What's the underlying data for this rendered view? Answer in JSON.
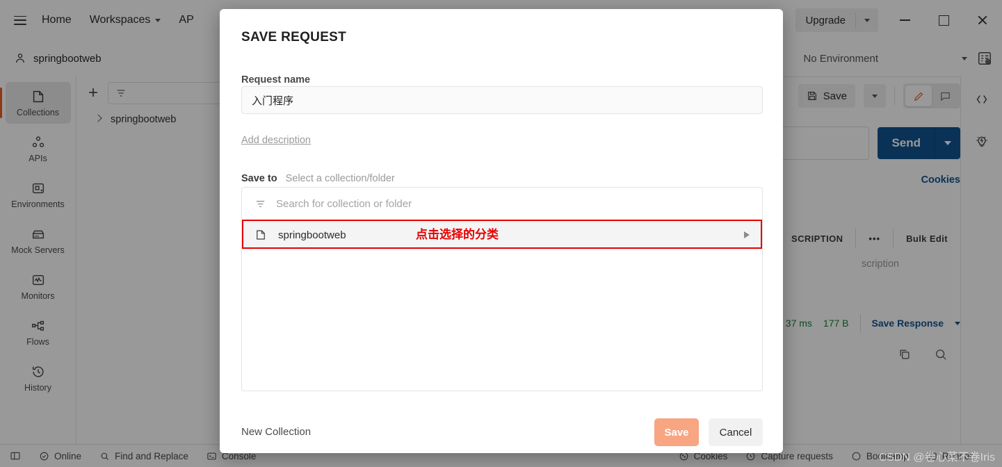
{
  "topbar": {
    "menu_icon": "hamburger-icon",
    "home": "Home",
    "workspaces": "Workspaces",
    "apis_partial": "AP",
    "upgrade": "Upgrade",
    "window_minimize": "minimize-icon",
    "window_maximize": "maximize-icon",
    "window_close": "close-icon"
  },
  "workspace_bar": {
    "name": "springbootweb",
    "environment": "No Environment",
    "env_quicklook_icon": "environment-quicklook-icon"
  },
  "sidebar": {
    "items": [
      {
        "label": "Collections",
        "icon": "collections-icon",
        "active": true
      },
      {
        "label": "APIs",
        "icon": "apis-icon",
        "active": false
      },
      {
        "label": "Environments",
        "icon": "environments-icon",
        "active": false
      },
      {
        "label": "Mock Servers",
        "icon": "mock-servers-icon",
        "active": false
      },
      {
        "label": "Monitors",
        "icon": "monitors-icon",
        "active": false
      },
      {
        "label": "Flows",
        "icon": "flows-icon",
        "active": false
      },
      {
        "label": "History",
        "icon": "history-icon",
        "active": false
      }
    ],
    "accent_color": "#ef5b25"
  },
  "collections_panel": {
    "new_icon": "plus-icon",
    "filter_icon": "filter-icon",
    "tree_items": [
      {
        "label": "springbootweb",
        "expand_icon": "chevron-right-icon"
      }
    ]
  },
  "request_area": {
    "save_label": "Save",
    "save_icon": "floppy-disk-icon",
    "save_caret_icon": "chevron-down-icon",
    "edit_icon": "pencil-icon",
    "comment_icon": "comment-icon",
    "send_label": "Send",
    "send_caret_icon": "chevron-down-icon",
    "send_color": "#11548f",
    "cookies_label": "Cookies",
    "params_headers": [
      "SCRIPTION"
    ],
    "more_icon": "ellipsis-icon",
    "bulk_edit_label": "Bulk Edit",
    "description_placeholder": "scription",
    "response_time": "37 ms",
    "response_size": "177 B",
    "save_response_label": "Save Response",
    "save_response_caret": "chevron-down-icon",
    "copy_icon": "copy-icon",
    "search_icon": "search-icon"
  },
  "right_rail": {
    "code_icon": "code-icon",
    "bulb_icon": "lightbulb-icon"
  },
  "statusbar": {
    "left": [
      {
        "label": "",
        "icon": "sidebar-toggle-icon"
      },
      {
        "label": "Online",
        "icon": "check-circle-icon"
      },
      {
        "label": "Find and Replace",
        "icon": "search-icon"
      },
      {
        "label": "Console",
        "icon": "terminal-icon"
      }
    ],
    "right": [
      {
        "label": "Cookies",
        "icon": "cookie-icon"
      },
      {
        "label": "Capture requests",
        "icon": "capture-icon"
      },
      {
        "label": "Bootcamp",
        "icon": "bootcamp-icon"
      },
      {
        "label": "Runner",
        "icon": "runner-icon"
      }
    ]
  },
  "modal": {
    "title": "SAVE REQUEST",
    "request_name_label": "Request name",
    "request_name_value": "入门程序",
    "add_description_label": "Add description",
    "save_to_label": "Save to",
    "save_to_value": "Select a collection/folder",
    "search_placeholder": "Search for collection or folder",
    "search_icon": "filter-icon",
    "list_items": [
      {
        "label": "springbootweb",
        "icon": "folder-icon",
        "expand_icon": "triangle-right-icon"
      }
    ],
    "new_collection_label": "New Collection",
    "save_button": "Save",
    "cancel_button": "Cancel",
    "save_button_color": "#f8a582"
  },
  "annotation": {
    "text": "点击选择的分类",
    "color": "#e60000"
  },
  "watermark": {
    "text": "CSDN @卷心菜不卷Iris"
  }
}
